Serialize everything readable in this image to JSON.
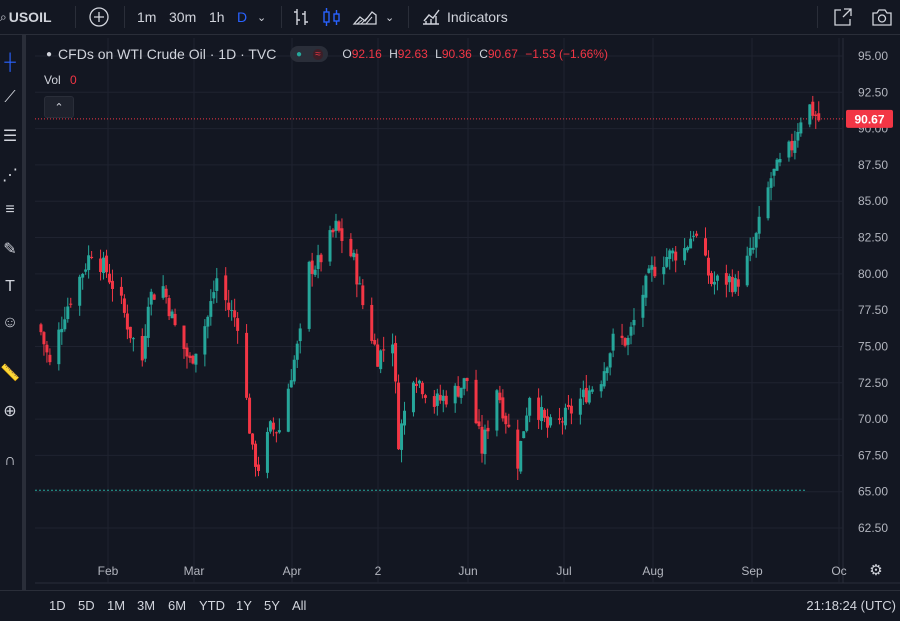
{
  "toolbar": {
    "symbol": "USOIL",
    "intervals": [
      "1m",
      "30m",
      "1h",
      "D"
    ],
    "indicators_label": "Indicators"
  },
  "legend": {
    "title": "CFDs on WTI Crude Oil · 1D · TVC",
    "o_label": "O",
    "o": "92.16",
    "h_label": "H",
    "h": "92.63",
    "l_label": "L",
    "l": "90.36",
    "c_label": "C",
    "c": "90.67",
    "change": "−1.53 (−1.66%)",
    "vol_label": "Vol",
    "vol": "0"
  },
  "ranges": [
    "1D",
    "5D",
    "1M",
    "3M",
    "6M",
    "YTD",
    "1Y",
    "5Y",
    "All"
  ],
  "clock": "21:18:24 (UTC)",
  "colors": {
    "up": "#26a69a",
    "down": "#f23645",
    "bg": "#131722",
    "grid": "#1f2330"
  },
  "chart_data": {
    "type": "candlestick",
    "title": "CFDs on WTI Crude Oil · 1D · TVC",
    "ylim": [
      61,
      96
    ],
    "y_ticks": [
      "95.00",
      "92.50",
      "90.00",
      "87.50",
      "85.00",
      "82.50",
      "80.00",
      "77.50",
      "75.00",
      "72.50",
      "70.00",
      "67.50",
      "65.00",
      "62.50"
    ],
    "x_ticks": [
      "Feb",
      "Mar",
      "Apr",
      "2",
      "Jun",
      "Jul",
      "Aug",
      "Sep",
      "Oc"
    ],
    "last_price": "90.67",
    "reference_line": 65.1,
    "points": [
      [
        "2023-01-03",
        76.0
      ],
      [
        "2023-01-06",
        73.7
      ],
      [
        "2023-01-11",
        77.4
      ],
      [
        "2023-01-17",
        80.2
      ],
      [
        "2023-01-20",
        81.6
      ],
      [
        "2023-01-25",
        80.2
      ],
      [
        "2023-01-30",
        77.9
      ],
      [
        "2023-02-02",
        75.9
      ],
      [
        "2023-02-06",
        74.1
      ],
      [
        "2023-02-08",
        78.4
      ],
      [
        "2023-02-13",
        79.1
      ],
      [
        "2023-02-17",
        76.3
      ],
      [
        "2023-02-22",
        73.9
      ],
      [
        "2023-02-28",
        77.0
      ],
      [
        "2023-03-03",
        79.7
      ],
      [
        "2023-03-07",
        77.6
      ],
      [
        "2023-03-10",
        76.7
      ],
      [
        "2023-03-15",
        67.6
      ],
      [
        "2023-03-17",
        66.7
      ],
      [
        "2023-03-21",
        69.3
      ],
      [
        "2023-03-24",
        69.3
      ],
      [
        "2023-03-28",
        73.2
      ],
      [
        "2023-03-31",
        75.7
      ],
      [
        "2023-04-03",
        80.4
      ],
      [
        "2023-04-06",
        80.7
      ],
      [
        "2023-04-12",
        83.2
      ],
      [
        "2023-04-18",
        80.9
      ],
      [
        "2023-04-21",
        77.9
      ],
      [
        "2023-04-26",
        74.3
      ],
      [
        "2023-05-01",
        75.6
      ],
      [
        "2023-05-03",
        68.6
      ],
      [
        "2023-05-08",
        73.2
      ],
      [
        "2023-05-15",
        71.1
      ],
      [
        "2023-05-22",
        71.9
      ],
      [
        "2023-05-26",
        72.7
      ],
      [
        "2023-05-31",
        67.9
      ],
      [
        "2023-06-05",
        72.2
      ],
      [
        "2023-06-12",
        67.1
      ],
      [
        "2023-06-16",
        71.8
      ],
      [
        "2023-06-22",
        69.4
      ],
      [
        "2023-06-26",
        69.7
      ],
      [
        "2023-06-30",
        70.6
      ],
      [
        "2023-07-05",
        71.8
      ],
      [
        "2023-07-10",
        72.9
      ],
      [
        "2023-07-14",
        75.4
      ],
      [
        "2023-07-19",
        75.4
      ],
      [
        "2023-07-24",
        78.7
      ],
      [
        "2023-07-27",
        80.2
      ],
      [
        "2023-08-01",
        81.2
      ],
      [
        "2023-08-07",
        81.7
      ],
      [
        "2023-08-10",
        83.0
      ],
      [
        "2023-08-16",
        79.4
      ],
      [
        "2023-08-22",
        79.6
      ],
      [
        "2023-08-24",
        79.2
      ],
      [
        "2023-08-30",
        81.7
      ],
      [
        "2023-09-05",
        86.6
      ],
      [
        "2023-09-08",
        87.5
      ],
      [
        "2023-09-12",
        88.8
      ],
      [
        "2023-09-15",
        90.8
      ],
      [
        "2023-09-18",
        91.5
      ],
      [
        "2023-09-19",
        91.2
      ],
      [
        "2023-09-21",
        90.6
      ]
    ]
  }
}
